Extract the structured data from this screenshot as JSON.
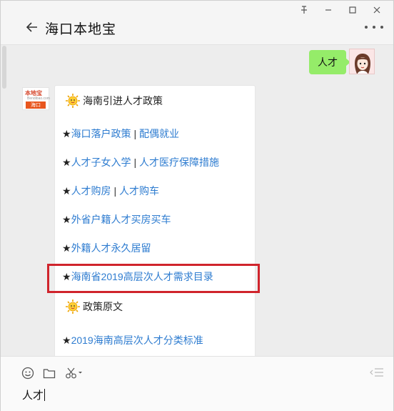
{
  "window": {
    "title": "海口本地宝",
    "controls": [
      "pin",
      "minimize",
      "maximize",
      "close"
    ]
  },
  "chat": {
    "my_message": "人才",
    "bot_avatar": {
      "logo_text": "本地宝",
      "logo_sub": "Bendibao.com",
      "city": "海口"
    },
    "card": {
      "section1_title": "海南引进人才政策",
      "items": [
        {
          "star": "★",
          "parts": [
            "海口落户政策",
            "配偶就业"
          ]
        },
        {
          "star": "★",
          "parts": [
            "人才子女入学",
            "人才医疗保障措施"
          ]
        },
        {
          "star": "★",
          "parts": [
            "人才购房",
            "人才购车"
          ]
        },
        {
          "star": "★",
          "parts": [
            "外省户籍人才买房买车"
          ]
        },
        {
          "star": "★",
          "parts": [
            "外籍人才永久居留"
          ]
        },
        {
          "star": "★",
          "parts": [
            "海南省2019高层次人才需求目录"
          ]
        }
      ],
      "separator": "|",
      "section2_title": "政策原文",
      "items2": [
        {
          "star": "★",
          "parts": [
            "2019海南高层次人才分类标准"
          ]
        }
      ]
    }
  },
  "composer": {
    "input_value": "人才",
    "tools": [
      "emoji-icon",
      "folder-icon",
      "scissors-icon"
    ]
  },
  "colors": {
    "accent_green": "#95ec69",
    "link_blue": "#2e7cd0",
    "highlight_red": "#d0242c"
  }
}
